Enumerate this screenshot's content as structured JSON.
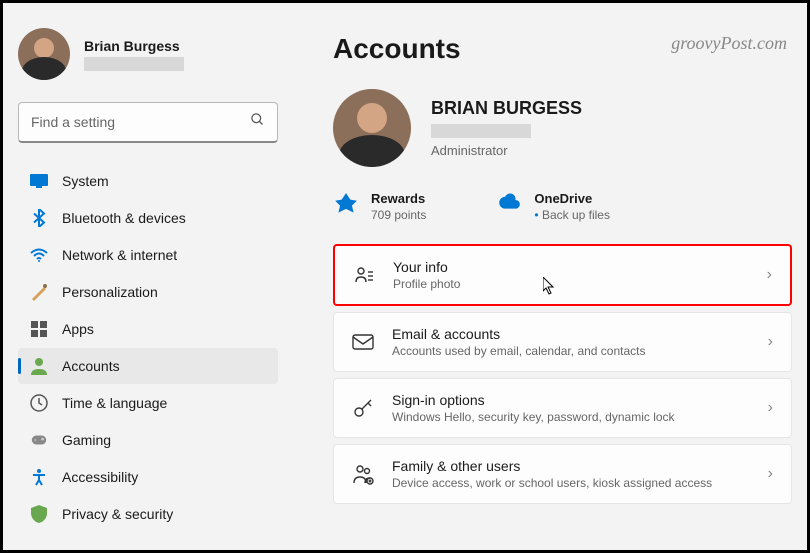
{
  "user": {
    "name": "Brian Burgess"
  },
  "search": {
    "placeholder": "Find a setting"
  },
  "nav": {
    "items": [
      {
        "label": "System",
        "icon": "system"
      },
      {
        "label": "Bluetooth & devices",
        "icon": "bluetooth"
      },
      {
        "label": "Network & internet",
        "icon": "network"
      },
      {
        "label": "Personalization",
        "icon": "personalization"
      },
      {
        "label": "Apps",
        "icon": "apps"
      },
      {
        "label": "Accounts",
        "icon": "accounts"
      },
      {
        "label": "Time & language",
        "icon": "time"
      },
      {
        "label": "Gaming",
        "icon": "gaming"
      },
      {
        "label": "Accessibility",
        "icon": "accessibility"
      },
      {
        "label": "Privacy & security",
        "icon": "privacy"
      }
    ],
    "active_index": 5
  },
  "page_title": "Accounts",
  "profile": {
    "name": "BRIAN BURGESS",
    "role": "Administrator"
  },
  "status": {
    "rewards": {
      "title": "Rewards",
      "sub": "709 points"
    },
    "onedrive": {
      "title": "OneDrive",
      "sub": "Back up files"
    }
  },
  "cards": [
    {
      "title": "Your info",
      "sub": "Profile photo",
      "highlighted": true,
      "icon": "profile"
    },
    {
      "title": "Email & accounts",
      "sub": "Accounts used by email, calendar, and contacts",
      "icon": "email"
    },
    {
      "title": "Sign-in options",
      "sub": "Windows Hello, security key, password, dynamic lock",
      "icon": "key"
    },
    {
      "title": "Family & other users",
      "sub": "Device access, work or school users, kiosk assigned access",
      "icon": "family"
    }
  ],
  "watermark": "groovyPost.com"
}
